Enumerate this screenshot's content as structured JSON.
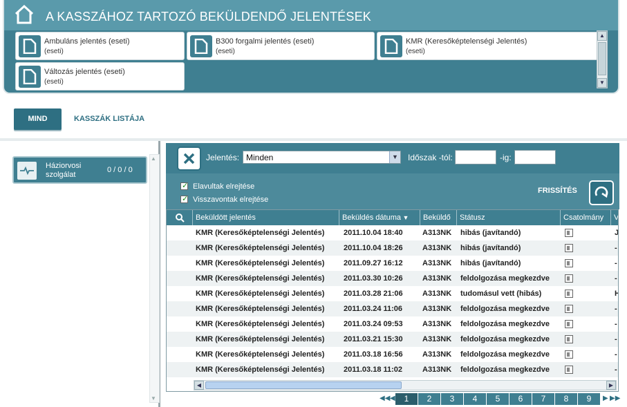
{
  "header": {
    "title": "A KASSZÁHOZ TARTOZÓ BEKÜLDENDŐ JELENTÉSEK"
  },
  "reports": [
    {
      "title": "Ambuláns jelentés (eseti)",
      "sub": "(eseti)"
    },
    {
      "title": "B300 forgalmi jelentés (eseti)",
      "sub": "(eseti)"
    },
    {
      "title": "KMR (Keresőképtelenségi Jelentés)",
      "sub": "(eseti)"
    },
    {
      "title": "Változás jelentés (eseti)",
      "sub": "(eseti)"
    }
  ],
  "tabs": {
    "mind": "MIND",
    "kasszak": "KASSZÁK LISTÁJA"
  },
  "cashier": {
    "label": "Háziorvosi szolgálat",
    "counts": "0 / 0 / 0"
  },
  "filters": {
    "report_label": "Jelentés:",
    "report_value": "Minden",
    "period_from_label": "Időszak -tól:",
    "period_to_label": "-ig:",
    "hide_expired": "Elavultak elrejtése",
    "hide_withdrawn": "Visszavontak elrejtése",
    "refresh_label": "FRISSÍTÉS"
  },
  "table": {
    "headers": {
      "sent": "Beküldött jelentés",
      "date": "Beküldés dátuma",
      "sender": "Beküldő",
      "status": "Státusz",
      "attachment": "Csatolmány",
      "extra": "V"
    },
    "rows": [
      {
        "report": "KMR (Keresőképtelenségi Jelentés)",
        "date": "2011.10.04 18:40",
        "sender": "A313NK",
        "status": "hibás (javítandó)",
        "extra": "J"
      },
      {
        "report": "KMR (Keresőképtelenségi Jelentés)",
        "date": "2011.10.04 18:26",
        "sender": "A313NK",
        "status": "hibás (javítandó)",
        "extra": "-"
      },
      {
        "report": "KMR (Keresőképtelenségi Jelentés)",
        "date": "2011.09.27 16:12",
        "sender": "A313NK",
        "status": "hibás (javítandó)",
        "extra": "-"
      },
      {
        "report": "KMR (Keresőképtelenségi Jelentés)",
        "date": "2011.03.30 10:26",
        "sender": "A313NK",
        "status": "feldolgozása megkezdve",
        "extra": "-"
      },
      {
        "report": "KMR (Keresőképtelenségi Jelentés)",
        "date": "2011.03.28 21:06",
        "sender": "A313NK",
        "status": "tudomásul vett (hibás)",
        "extra": "H"
      },
      {
        "report": "KMR (Keresőképtelenségi Jelentés)",
        "date": "2011.03.24 11:06",
        "sender": "A313NK",
        "status": "feldolgozása megkezdve",
        "extra": "-"
      },
      {
        "report": "KMR (Keresőképtelenségi Jelentés)",
        "date": "2011.03.24 09:53",
        "sender": "A313NK",
        "status": "feldolgozása megkezdve",
        "extra": "-"
      },
      {
        "report": "KMR (Keresőképtelenségi Jelentés)",
        "date": "2011.03.21 15:30",
        "sender": "A313NK",
        "status": "feldolgozása megkezdve",
        "extra": "-"
      },
      {
        "report": "KMR (Keresőképtelenségi Jelentés)",
        "date": "2011.03.18 16:56",
        "sender": "A313NK",
        "status": "feldolgozása megkezdve",
        "extra": "-"
      },
      {
        "report": "KMR (Keresőképtelenségi Jelentés)",
        "date": "2011.03.18 11:02",
        "sender": "A313NK",
        "status": "feldolgozása megkezdve",
        "extra": "-"
      }
    ]
  },
  "pager": {
    "pages": [
      "1",
      "2",
      "3",
      "4",
      "5",
      "6",
      "7",
      "8",
      "9"
    ],
    "active": "1"
  },
  "colors": {
    "primary": "#3f7f91",
    "header": "#5a9aab",
    "dark": "#2e6f82"
  }
}
